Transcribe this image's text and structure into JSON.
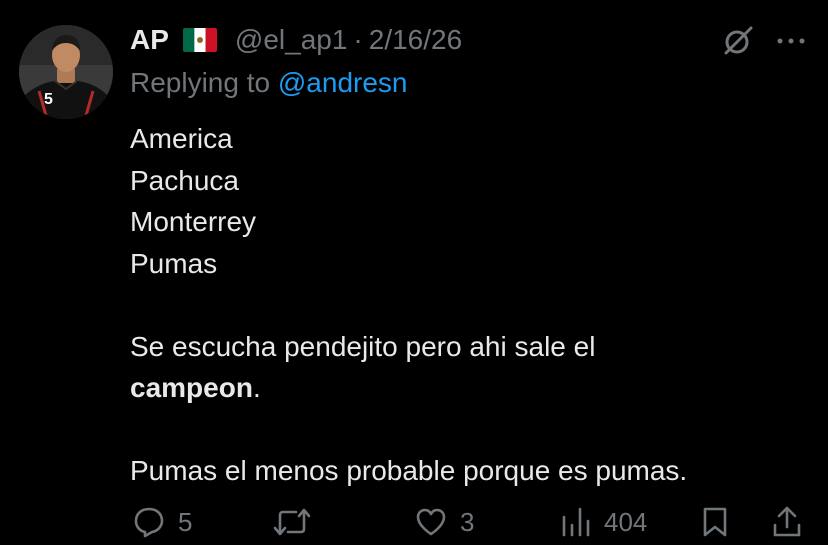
{
  "tweet": {
    "display_name": "AP",
    "flag_icon": "mexico-flag-icon",
    "handle": "@el_ap1",
    "separator": "·",
    "date": "2/16/26",
    "replying_prefix": "Replying to ",
    "replying_to": "@andresn",
    "lines": [
      "America",
      "Pachuca",
      "Monterrey",
      "Pumas"
    ],
    "paragraph2_text": "Se escucha pendejito pero ahi sale el",
    "paragraph2_bold": "campeon",
    "paragraph2_end": ".",
    "paragraph3": "Pumas el menos probable porque es pumas."
  },
  "avatar": {
    "jersey_number": "5"
  },
  "actions": {
    "replies": "5",
    "retweets": "",
    "likes": "3",
    "views": "404"
  },
  "colors": {
    "background": "#000000",
    "text": "#e7e9ea",
    "secondary": "#71767b",
    "link": "#1d9bf0",
    "mexico_green": "#006847",
    "mexico_red": "#ce1126"
  }
}
